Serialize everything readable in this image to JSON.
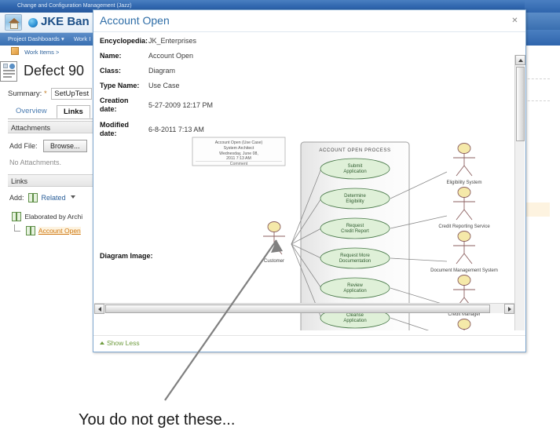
{
  "chrome": {
    "window_title": "Change and Configuration Management (Jazz)",
    "app_name": "JKE Ban",
    "nav_items": [
      "Project Dashboards ▾",
      "Work I"
    ],
    "breadcrumb": "Work Items >"
  },
  "workitem": {
    "title": "Defect 90",
    "summary_label": "Summary:",
    "summary_required": "*",
    "summary_value": "SetUpTest",
    "tabs": [
      {
        "label": "Overview",
        "active": false
      },
      {
        "label": "Links",
        "active": true
      }
    ],
    "attachments": {
      "section_label": "Attachments",
      "add_file_label": "Add File:",
      "browse_label": "Browse...",
      "empty_text": "No Attachments."
    },
    "links": {
      "section_label": "Links",
      "add_label": "Add:",
      "related_label": "Related",
      "group_label": "Elaborated by Archi",
      "child_label": "Account Open"
    }
  },
  "dialog": {
    "title": "Account Open",
    "close_label": "✕",
    "properties": [
      {
        "key": "Encyclopedia:",
        "value": "JK_Enterprises",
        "lines": 1
      },
      {
        "key": "Name:",
        "value": "Account Open",
        "lines": 1
      },
      {
        "key": "Class:",
        "value": "Diagram",
        "lines": 1
      },
      {
        "key": "Type Name:",
        "value": "Use Case",
        "lines": 1
      },
      {
        "key": "Creation date:",
        "value": "5-27-2009 12:17 PM",
        "lines": 2
      },
      {
        "key": "Modified date:",
        "value": "6-8-2011 7:13 AM",
        "lines": 2
      }
    ],
    "diagram_image_label": "Diagram Image:",
    "show_less_label": "Show Less"
  },
  "diagram": {
    "comment_box": [
      "Account Open (Use Case)",
      "System Architect",
      "Wednesday, June 08,",
      "2011 7:13 AM",
      "Comment"
    ],
    "process_title": "ACCOUNT OPEN PROCESS",
    "use_cases": [
      "Submit Application",
      "Determine Eligibility",
      "Request Credit Report",
      "Request More Documentation",
      "Review Application",
      "Cleanse Application"
    ],
    "left_actor": "Customer",
    "right_actors": [
      "Eligibility System",
      "Credit Reporting Service",
      "Document Management System",
      "Credit Manager",
      ""
    ],
    "colors": {
      "usecase_fill": "#dff0d8",
      "usecase_stroke": "#4a7a4a",
      "actor_head": "#f5e9a9",
      "actor_stroke": "#8b5f5f",
      "process_stroke": "#9a9a9a"
    }
  },
  "annotation": {
    "text": "You do not get these..."
  }
}
